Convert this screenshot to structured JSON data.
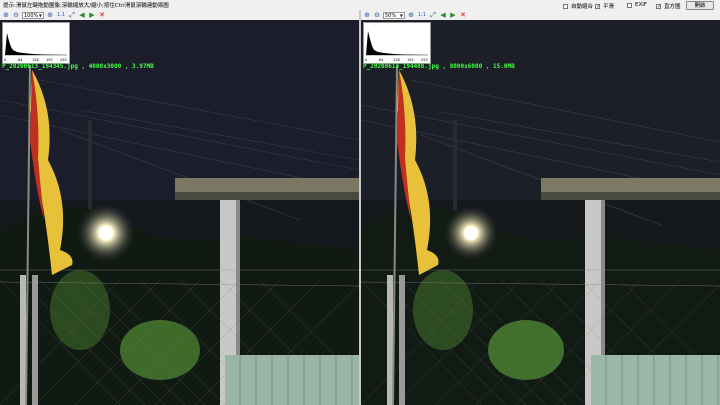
{
  "hint": "提示:滑鼠左鍵拖動圖像;滾輪縮放大/縮小;按住Ctrl滑鼠滾輪連動兩圖",
  "options": [
    {
      "label": "自動縮合",
      "checked": false
    },
    {
      "label": "平滑",
      "checked": true
    },
    {
      "label": "EXIF",
      "checked": false
    },
    {
      "label": "直方圖",
      "checked": true
    }
  ],
  "open_label": "開啟",
  "panes": [
    {
      "zoom": "100%",
      "ratio": "1:1",
      "file": "P_20200613_194345.jpg , 4000x3000 , 3.97MB"
    },
    {
      "zoom": "50%",
      "ratio": "1:1",
      "file": "P_20200613_194408.jpg , 8000x6000 , 15.0MB"
    }
  ],
  "hist_ticks": [
    "0",
    "64",
    "128",
    "192",
    "255"
  ],
  "icons": {
    "zoom_in": "zoom-in-icon",
    "zoom_out": "zoom-out-icon",
    "fit": "fit-icon",
    "prev": "previous-icon",
    "next": "next-icon",
    "close": "close-icon"
  }
}
